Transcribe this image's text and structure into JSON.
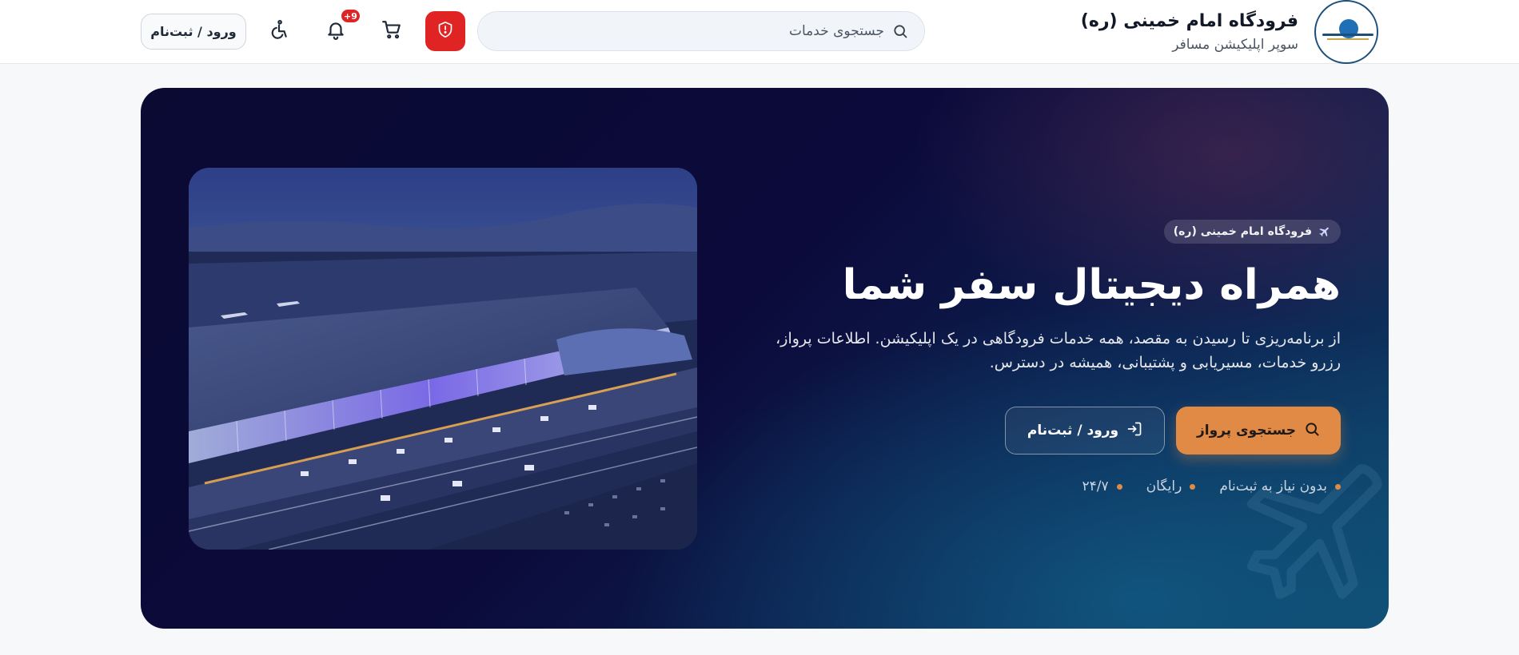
{
  "header": {
    "brand_title": "فرودگاه امام خمینی (ره)",
    "brand_subtitle": "سوپر اپلیکیشن مسافر",
    "search_placeholder": "جستجوی خدمات",
    "notification_count": "+9",
    "login_label": "ورود / ثبت‌نام",
    "icons": {
      "search": "search-icon",
      "shield": "shield-alert-icon",
      "cart": "cart-icon",
      "bell": "bell-icon",
      "accessibility": "accessibility-icon"
    },
    "colors": {
      "shield_bg": "#e02424",
      "badge_bg": "#dc2626"
    }
  },
  "hero": {
    "chip_label": "فرودگاه امام خمینی (ره)",
    "title": "همراه دیجیتال سفر شما",
    "description": "از برنامه‌ریزی تا رسیدن به مقصد، همه خدمات فرودگاهی در یک اپلیکیشن. اطلاعات پرواز، رزرو خدمات، مسیریابی و پشتیبانی، همیشه در دسترس.",
    "cta_primary": "جستجوی پرواز",
    "cta_secondary": "ورود / ثبت‌نام",
    "features": [
      "بدون نیاز به ثبت‌نام",
      "رایگان",
      "۲۴/۷"
    ],
    "colors": {
      "accent": "#e08a45",
      "bg_dark": "#0a0a33",
      "bg_teal": "#0f4a6e"
    }
  }
}
